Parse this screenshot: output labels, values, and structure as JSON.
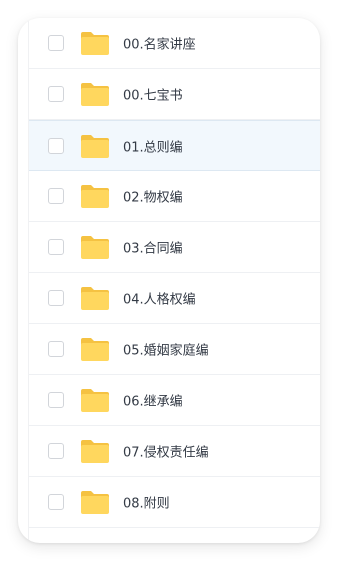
{
  "files": [
    {
      "name": "00.名家讲座",
      "selected": false,
      "checked": false,
      "icon": "folder-icon"
    },
    {
      "name": "00.七宝书",
      "selected": false,
      "checked": false,
      "icon": "folder-icon"
    },
    {
      "name": "01.总则编",
      "selected": true,
      "checked": false,
      "icon": "folder-icon"
    },
    {
      "name": "02.物权编",
      "selected": false,
      "checked": false,
      "icon": "folder-icon"
    },
    {
      "name": "03.合同编",
      "selected": false,
      "checked": false,
      "icon": "folder-icon"
    },
    {
      "name": "04.人格权编",
      "selected": false,
      "checked": false,
      "icon": "folder-icon"
    },
    {
      "name": "05.婚姻家庭编",
      "selected": false,
      "checked": false,
      "icon": "folder-icon"
    },
    {
      "name": "06.继承编",
      "selected": false,
      "checked": false,
      "icon": "folder-icon"
    },
    {
      "name": "07.侵权责任编",
      "selected": false,
      "checked": false,
      "icon": "folder-icon"
    },
    {
      "name": "08.附则",
      "selected": false,
      "checked": false,
      "icon": "folder-icon"
    }
  ],
  "colors": {
    "folder_body": "#ffd75e",
    "folder_tab": "#f5c242",
    "selected_row": "#f2f8fd",
    "text": "#333a45"
  }
}
